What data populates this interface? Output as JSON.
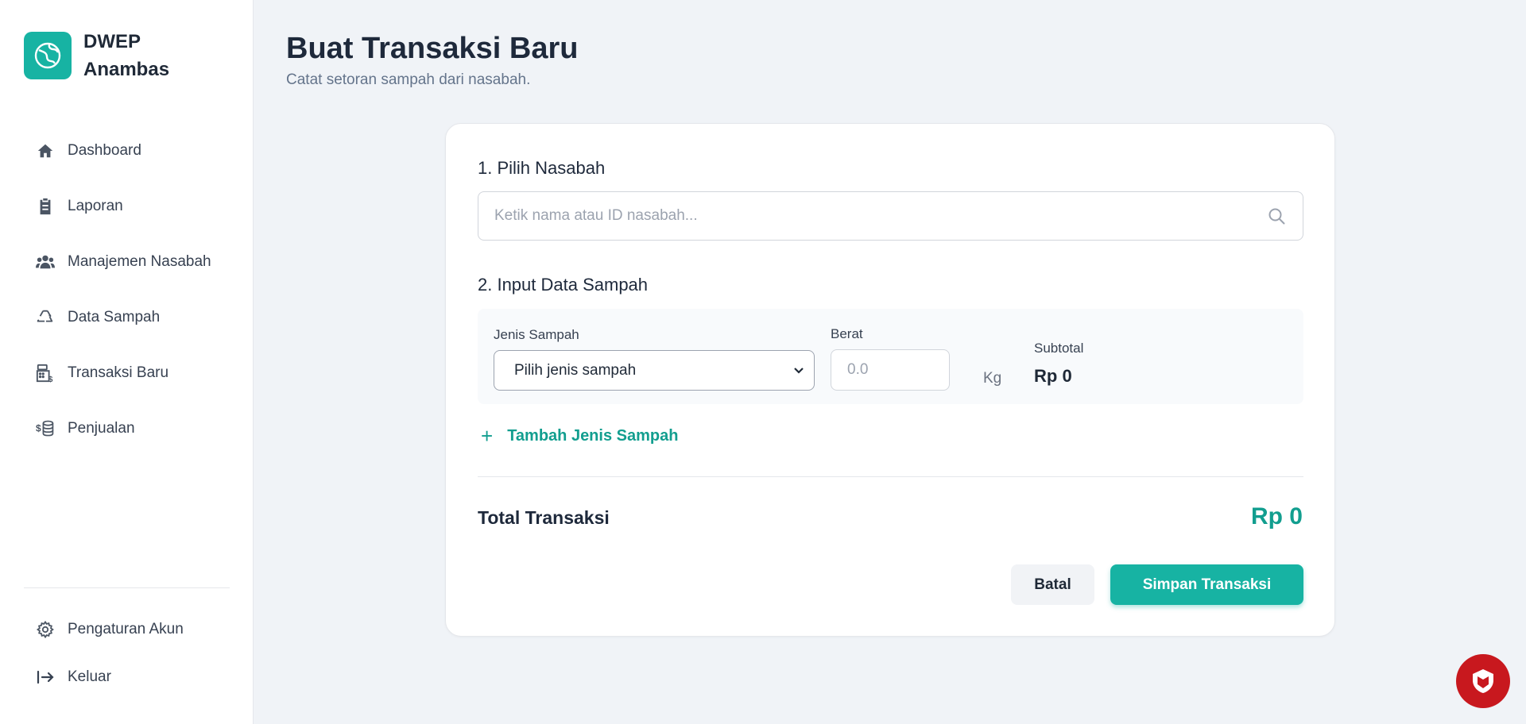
{
  "brand": {
    "name": "DWEP Anambas",
    "logo_icon": "globe-icon",
    "color": "#17b3a3"
  },
  "sidebar": {
    "items": [
      {
        "label": "Dashboard",
        "icon": "home-icon"
      },
      {
        "label": "Laporan",
        "icon": "clipboard-icon"
      },
      {
        "label": "Manajemen Nasabah",
        "icon": "users-icon"
      },
      {
        "label": "Data Sampah",
        "icon": "recycle-icon"
      },
      {
        "label": "Transaksi Baru",
        "icon": "cash-register-icon"
      },
      {
        "label": "Penjualan",
        "icon": "coins-icon"
      }
    ],
    "bottom": [
      {
        "label": "Pengaturan Akun",
        "icon": "gear-icon"
      },
      {
        "label": "Keluar",
        "icon": "logout-icon"
      }
    ]
  },
  "page": {
    "title": "Buat Transaksi Baru",
    "subtitle": "Catat setoran sampah dari nasabah."
  },
  "form": {
    "section1_title": "1. Pilih Nasabah",
    "search_placeholder": "Ketik nama atau ID nasabah...",
    "section2_title": "2. Input Data Sampah",
    "waste_type_label": "Jenis Sampah",
    "waste_type_selected": "Pilih jenis sampah",
    "weight_label": "Berat",
    "weight_placeholder": "0.0",
    "unit": "Kg",
    "subtotal_label": "Subtotal",
    "subtotal_value": "Rp 0",
    "add_item_label": "Tambah Jenis Sampah",
    "total_label": "Total Transaksi",
    "total_value": "Rp 0",
    "cancel_label": "Batal",
    "save_label": "Simpan Transaksi"
  },
  "colors": {
    "accent": "#17b3a3",
    "accent_text": "#129e8f",
    "fab": "#c8181e"
  }
}
